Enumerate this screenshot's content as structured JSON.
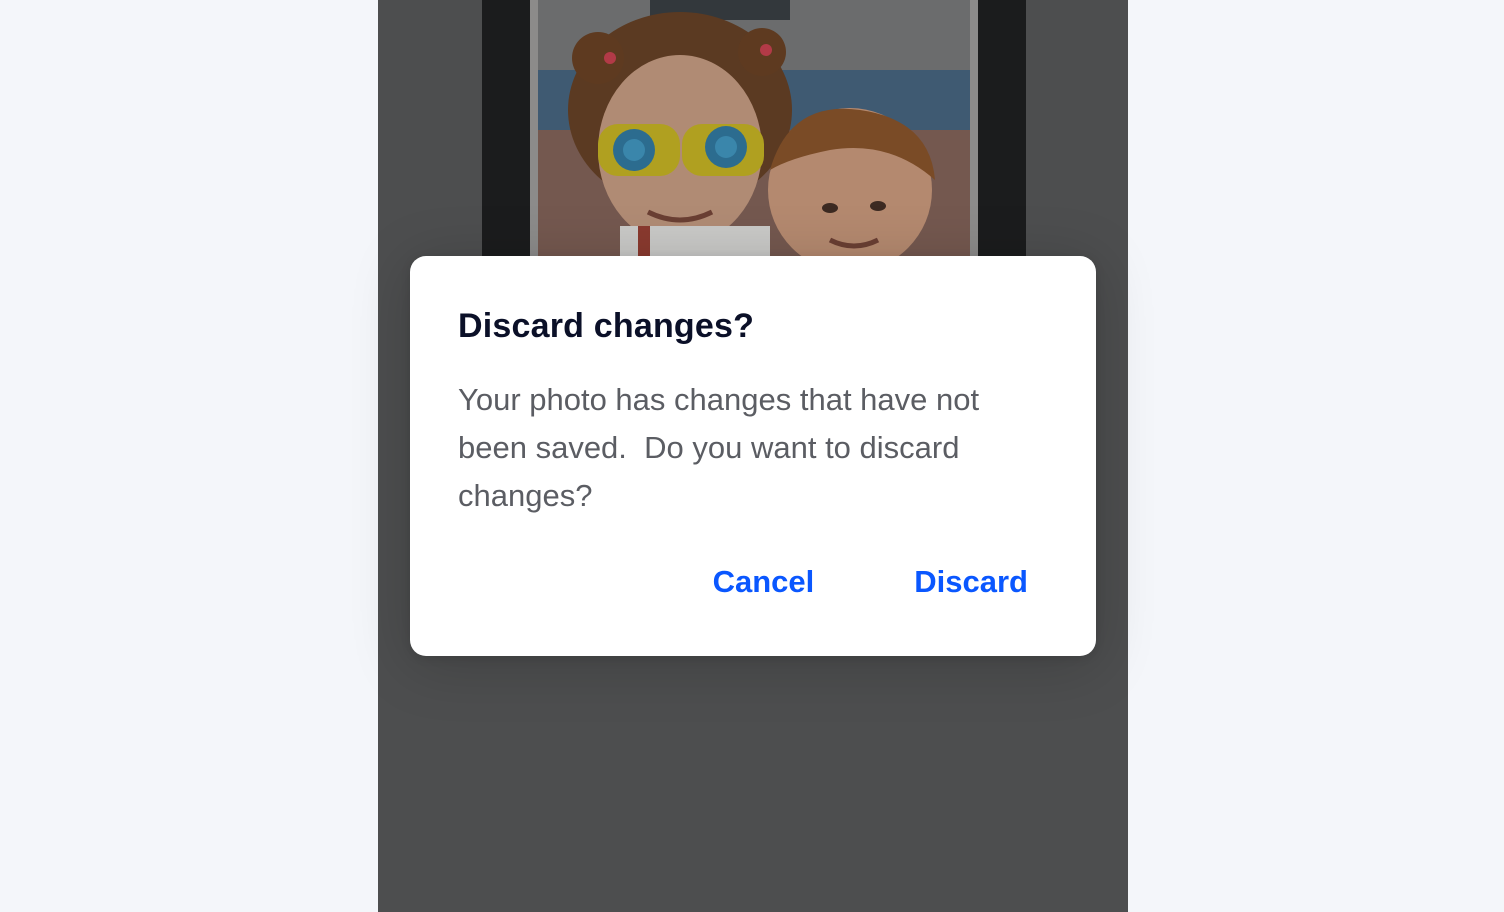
{
  "dialog": {
    "title": "Discard changes?",
    "message": "Your photo has changes that have not been saved.  Do you want to discard changes?",
    "cancel_label": "Cancel",
    "discard_label": "Discard"
  },
  "colors": {
    "accent": "#0a57ff",
    "title": "#0b1028",
    "body_text": "#5b5d63",
    "screen_background": "#4d4e4f",
    "page_background": "#f4f6fa"
  },
  "photo": {
    "subject": "photo-preview"
  }
}
